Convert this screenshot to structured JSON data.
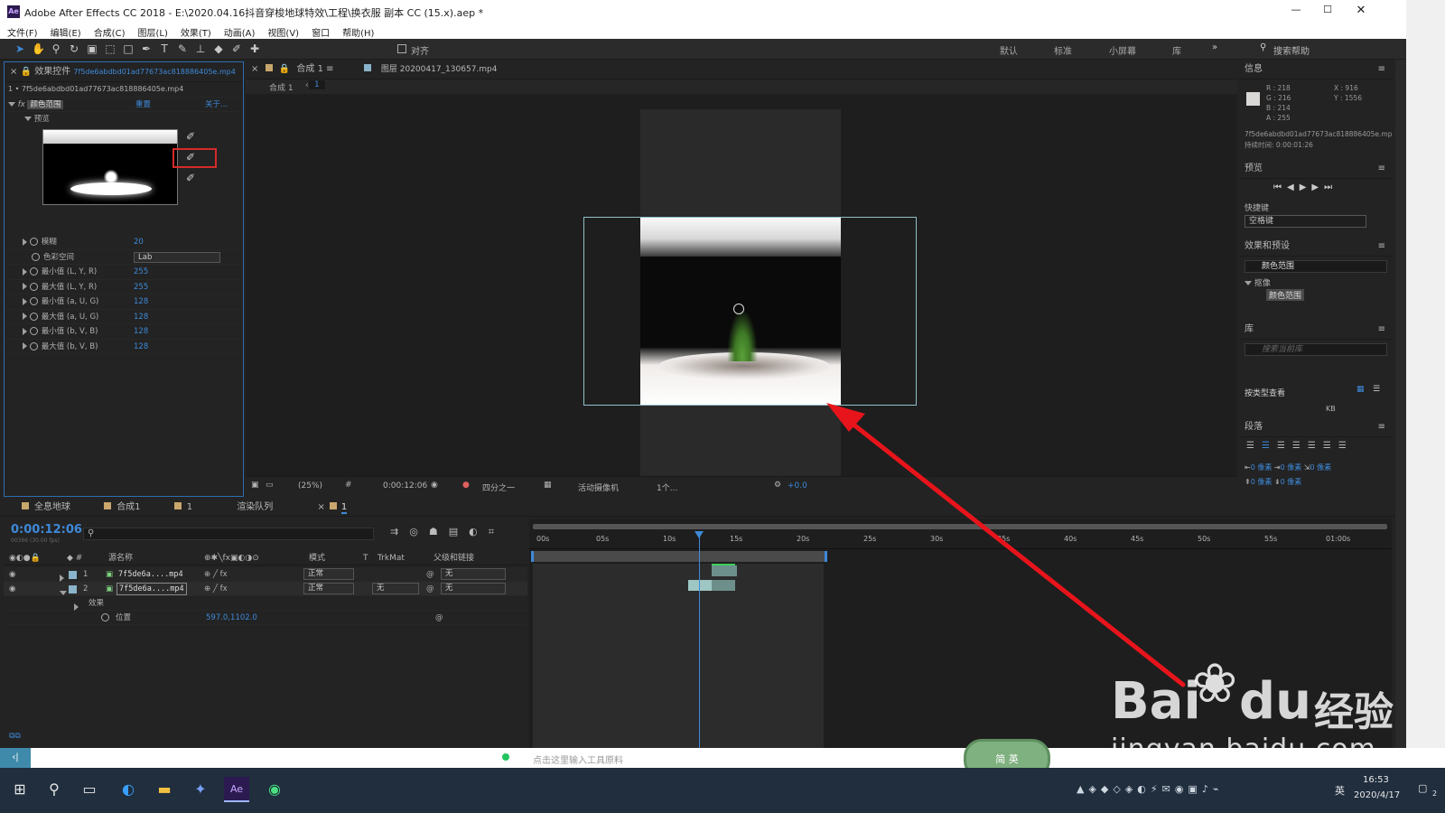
{
  "window": {
    "title": "Adobe After Effects CC 2018 - E:\\2020.04.16抖音穿梭地球特效\\工程\\换衣服 副本 CC (15.x).aep *",
    "app_badge": "Ae",
    "minimize": "—",
    "maximize": "☐",
    "close": "✕"
  },
  "menu": [
    "文件(F)",
    "编辑(E)",
    "合成(C)",
    "图层(L)",
    "效果(T)",
    "动画(A)",
    "视图(V)",
    "窗口",
    "帮助(H)"
  ],
  "toolbar": {
    "snap_label": "对齐",
    "workspaces": [
      "默认",
      "标准",
      "小屏幕",
      "库"
    ],
    "more": "»",
    "search_placeholder": "搜索帮助"
  },
  "effect_controls": {
    "tab": "效果控件",
    "tab_file": "7f5de6abdbd01ad77673ac818886405e.mp4",
    "layer_line": "1 • 7f5de6abdbd01ad77673ac818886405e.mp4",
    "effect_name": "颜色范围",
    "reset": "重置",
    "about": "关于...",
    "preview_label": "预览",
    "params": [
      {
        "name": "模糊",
        "value": "20"
      },
      {
        "name": "色彩空间",
        "value": "Lab"
      },
      {
        "name": "最小值 (L, Y, R)",
        "value": "255"
      },
      {
        "name": "最大值 (L, Y, R)",
        "value": "255"
      },
      {
        "name": "最小值 (a, U, G)",
        "value": "128"
      },
      {
        "name": "最大值 (a, U, G)",
        "value": "128"
      },
      {
        "name": "最小值 (b, V, B)",
        "value": "128"
      },
      {
        "name": "最大值 (b, V, B)",
        "value": "128"
      }
    ]
  },
  "comp_viewer": {
    "tabs": [
      "合成 1",
      "图层 20200417_130657.mp4"
    ],
    "breadcrumb": "合成 1",
    "breadcrumb_num": "1",
    "zoom": "(25%)",
    "timecode": "0:00:12:06",
    "resolution": "四分之一",
    "camera": "活动摄像机",
    "views": "1个...",
    "exposure": "+0.0"
  },
  "info": {
    "title": "信息",
    "r": "R : 218",
    "g": "G : 216",
    "b": "B : 214",
    "a": "A : 255",
    "x": "X : 916",
    "y": "Y : 1556",
    "file": "7f5de6abdbd01ad77673ac818886405e.mp",
    "duration": "持续时间: 0:00:01:26"
  },
  "preview_panel": {
    "title": "预览",
    "shortcut_label": "快捷键",
    "shortcut_value": "空格键"
  },
  "effects_presets": {
    "title": "效果和预设",
    "search_value": "颜色范围",
    "category": "抠像",
    "item": "颜色范围"
  },
  "library": {
    "title": "库",
    "search_placeholder": "搜索当前库",
    "view_label": "按类型查看",
    "kb": "KB"
  },
  "paragraph": {
    "title": "段落",
    "px1": "0 像素",
    "px2": "0 像素",
    "px3": "0 像素",
    "px4": "0 像素",
    "px5": "0 像素"
  },
  "timeline": {
    "tabs": [
      "全息地球",
      "合成1",
      "1",
      "渲染队列",
      "1"
    ],
    "timecode": "0:00:12:06",
    "frames": "00366 (30.00 fps)",
    "columns": {
      "name": "源名称",
      "mode": "模式",
      "t": "T",
      "trkmat": "TrkMat",
      "parent": "父级和链接"
    },
    "layers": [
      {
        "num": "1",
        "name": "7f5de6a....mp4",
        "mode": "正常",
        "trkmat": "",
        "parent": "无"
      },
      {
        "num": "2",
        "name": "7f5de6a....mp4",
        "mode": "正常",
        "trkmat": "无",
        "parent": "无"
      }
    ],
    "effects_label": "效果",
    "position_label": "位置",
    "position_value": "597.0,1102.0",
    "ruler": [
      "00s",
      "05s",
      "10s",
      "15s",
      "20s",
      "25s",
      "30s",
      "35s",
      "40s",
      "45s",
      "50s",
      "55s",
      "01:00s"
    ]
  },
  "web_bottom": {
    "placeholder": "点击这里输入工具原料",
    "ime": "简 英"
  },
  "watermark": {
    "brand": "Bai",
    "brand2": "du",
    "cn": "经验",
    "url": "jingyan.baidu.com"
  },
  "taskbar": {
    "time": "16:53",
    "date": "2020/4/17",
    "lang": "英",
    "notif": "2"
  },
  "colors": {
    "accent": "#3e89d8",
    "arrow": "#e8141b",
    "highlight": "#d62a2a",
    "bg": "#232323"
  }
}
